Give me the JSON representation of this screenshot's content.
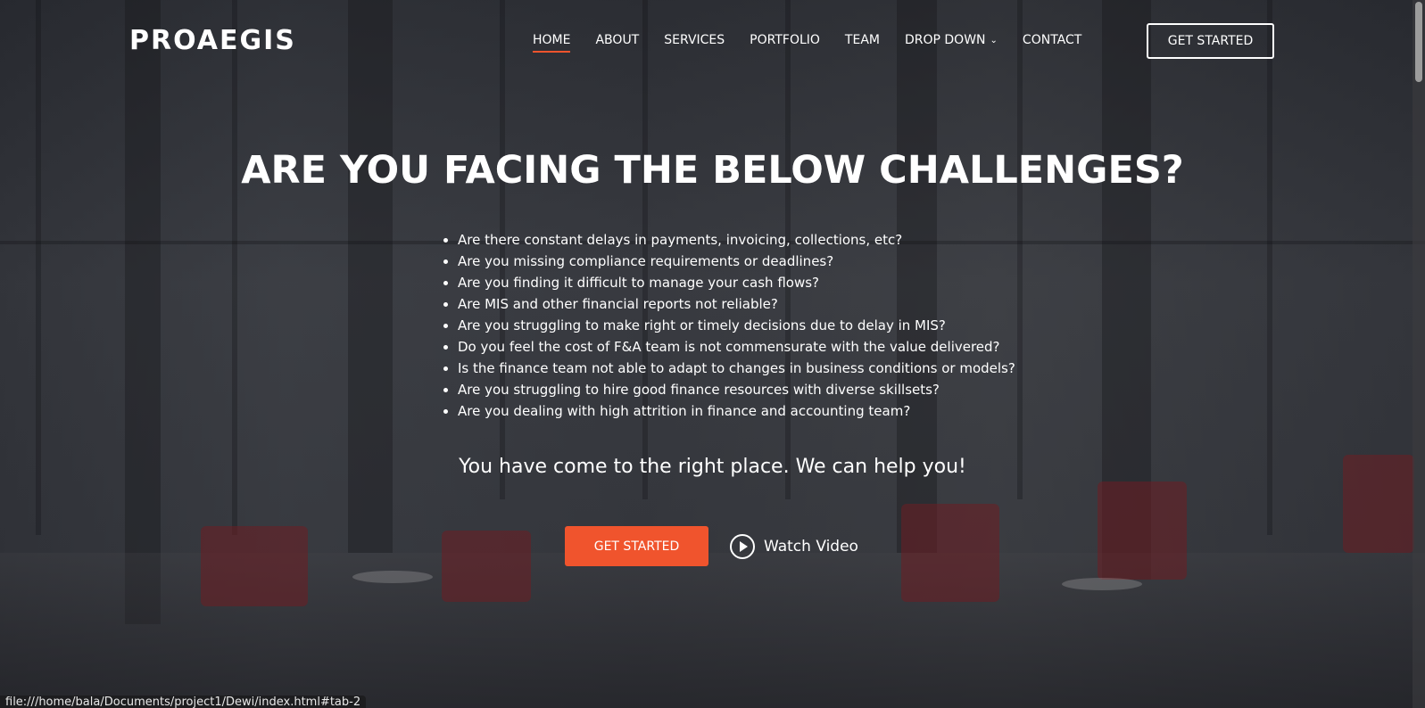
{
  "brand": {
    "logo": "PROAEGIS"
  },
  "nav": {
    "items": [
      {
        "label": "HOME",
        "active": true
      },
      {
        "label": "ABOUT"
      },
      {
        "label": "SERVICES"
      },
      {
        "label": "PORTFOLIO"
      },
      {
        "label": "TEAM"
      },
      {
        "label": "DROP DOWN",
        "icon": "chevron-down-icon"
      },
      {
        "label": "CONTACT"
      }
    ],
    "cta_label": "GET STARTED"
  },
  "hero": {
    "heading": "ARE YOU FACING THE BELOW CHALLENGES?",
    "challenges": [
      "Are there constant delays in payments, invoicing, collections, etc?",
      "Are you missing compliance requirements or deadlines?",
      "Are you finding it difficult to manage your cash flows?",
      "Are MIS and other financial reports not reliable?",
      "Are you struggling to make right or timely decisions due to delay in MIS?",
      "Do you feel the cost of F&A team is not commensurate with the value delivered?",
      "Is the finance team not able to adapt to changes in business conditions or models?",
      "Are you struggling to hire good finance resources with diverse skillsets?",
      "Are you dealing with high attrition in finance and accounting team?"
    ],
    "tagline": "You have come to the right place. We can help you!",
    "primary_button": "GET STARTED",
    "video_button": "Watch Video",
    "video_icon": "play-icon"
  },
  "colors": {
    "accent": "#f0542d",
    "text": "#ffffff"
  },
  "status_bar": {
    "url": "file:///home/bala/Documents/project1/Dewi/index.html#tab-2"
  }
}
